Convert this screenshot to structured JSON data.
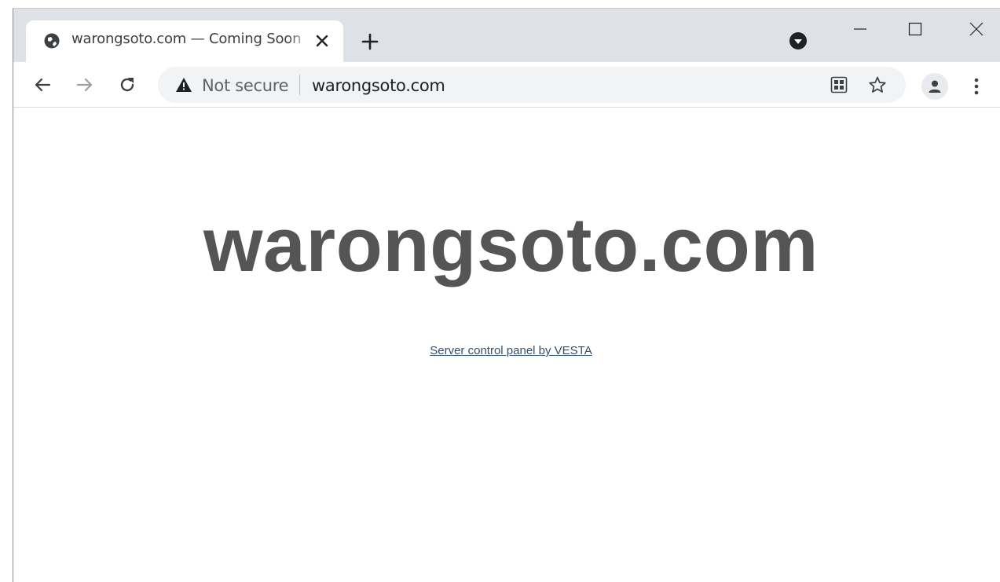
{
  "browser": {
    "tab": {
      "title": "warongsoto.com — Coming Soon",
      "favicon_icon": "globe-icon",
      "close_icon": "close-icon"
    },
    "new_tab_icon": "plus-icon",
    "tab_search_icon": "chevron-down-circle-icon",
    "window_controls": [
      "minimize-icon",
      "maximize-icon",
      "close-icon"
    ]
  },
  "toolbar": {
    "back_icon": "arrow-left-icon",
    "forward_icon": "arrow-right-icon",
    "reload_icon": "reload-icon",
    "omnibox": {
      "security_icon": "warning-triangle-icon",
      "security_label": "Not secure",
      "url": "warongsoto.com"
    },
    "right_icons": [
      "qr-code-icon",
      "star-icon",
      "profile-icon",
      "more-vert-icon"
    ]
  },
  "page": {
    "heading": "warongsoto.com",
    "footer_link": "Server control panel by VESTA",
    "heading_color": "#555555",
    "link_color": "#35506b"
  }
}
